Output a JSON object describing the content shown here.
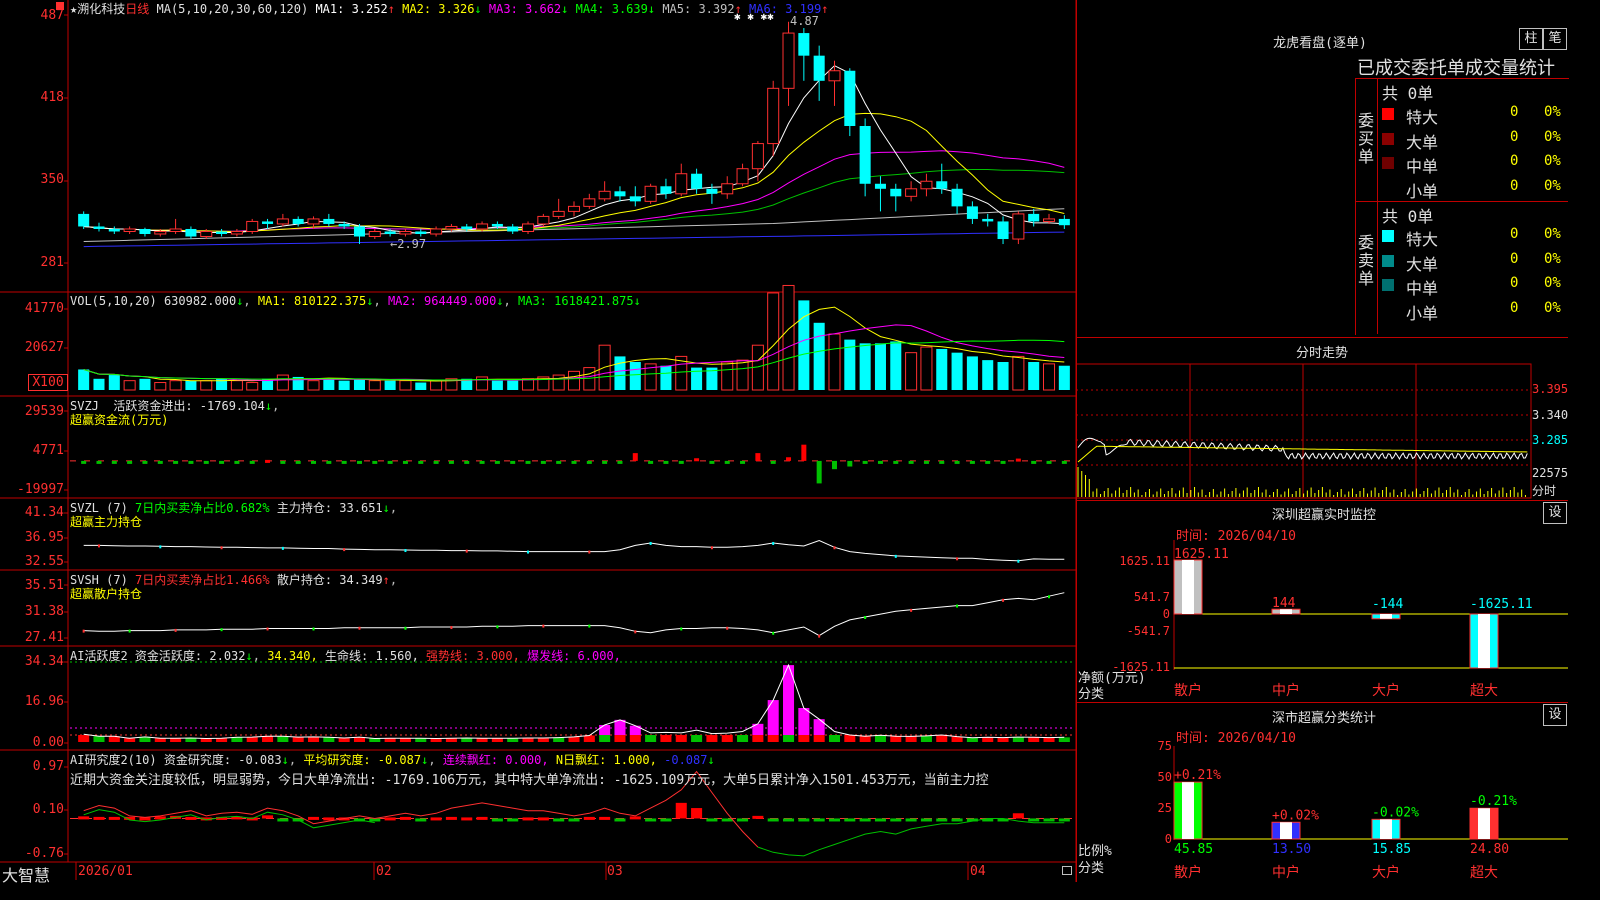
{
  "header": {
    "star": "★",
    "stock_name": "溯化科技",
    "period": "日线",
    "ma_label": "MA(5,10,20,30,60,120)",
    "ma1": "MA1: 3.252",
    "ma2": "MA2: 3.326",
    "ma3": "MA3: 3.662",
    "ma4": "MA4: 3.639",
    "ma5": "MA5: 3.392",
    "ma6": "MA6: 3.199",
    "up_arrow": "↑",
    "down_arrow": "↓",
    "peak_label": "4.87",
    "peak_marks": "✱  ✱  ✱✱",
    "low_label": "←2.97"
  },
  "price_axis": [
    "487",
    "418",
    "350",
    "281"
  ],
  "vol_header": {
    "label": "VOL(5,10,20)",
    "value": "630982.000",
    "ma1": "MA1: 810122.375",
    "ma2": "MA2: 964449.000",
    "ma3": "MA3: 1618421.875"
  },
  "vol_axis": [
    "41770",
    "20627",
    "X100"
  ],
  "svzj_header": {
    "code": "SVZJ",
    "text": "活跃资金进出: -1769.104",
    "sub": "超赢资金流(万元)"
  },
  "svzj_axis": [
    "29539",
    "4771",
    "-19997"
  ],
  "svzl_header": {
    "code": "SVZL (7)",
    "ratio": "7日内买卖净占比0.682%",
    "pos": "主力持仓: 33.651",
    "sub": "超赢主力持仓"
  },
  "svzl_axis": [
    "41.34",
    "36.95",
    "32.55"
  ],
  "svsh_header": {
    "code": "SVSH (7)",
    "ratio": "7日内买卖净占比1.466%",
    "pos": "散户持仓: 34.349",
    "sub": "超赢散户持仓"
  },
  "svsh_axis": [
    "35.51",
    "31.38",
    "27.41"
  ],
  "ai_active_header": {
    "code": "AI活跃度2",
    "a": "资金活跃度: 2.032",
    "b": "34.340,",
    "c": "生命线: 1.560,",
    "d": "强势线: 3.000,",
    "e": "爆发线: 6.000,"
  },
  "ai_active_axis": [
    "34.34",
    "16.96",
    "0.00"
  ],
  "ai_research_header": {
    "code": "AI研究度2(10)",
    "a": "资金研究度: -0.083",
    "b": "平均研究度: -0.087",
    "c": "连续飘红: 0.000,",
    "d": "N日飘红: 1.000,",
    "e": "-0.087",
    "summary": "近期大资金关注度较低，明显弱势，今日大单净流出: -1769.106万元，其中特大单净流出: -1625.109万元，大单5日累计净入1501.453万元，当前主力控"
  },
  "ai_research_axis": [
    "0.97",
    "0.10",
    "-0.76"
  ],
  "dates": [
    "2026/01",
    "02",
    "03",
    "04"
  ],
  "logo": "大智慧",
  "right": {
    "lhb_title": "龙虎看盘(逐单)",
    "btn_bar": "柱",
    "btn_pen": "笔",
    "stat_title": "已成交委托单成交量统计",
    "buy_label": "委买单",
    "sell_label": "委卖单",
    "buy_total": "共 0单",
    "sell_total": "共 0单",
    "buy_rows": [
      {
        "name": "特大",
        "v": "0",
        "p": "0%",
        "color": "#ff0000"
      },
      {
        "name": "大单",
        "v": "0",
        "p": "0%",
        "color": "#8b0000"
      },
      {
        "name": "中单",
        "v": "0",
        "p": "0%",
        "color": "#700000"
      },
      {
        "name": "小单",
        "v": "0",
        "p": "0%",
        "color": "#000000"
      }
    ],
    "sell_rows": [
      {
        "name": "特大",
        "v": "0",
        "p": "0%",
        "color": "#00ffff"
      },
      {
        "name": "大单",
        "v": "0",
        "p": "0%",
        "color": "#008b8b"
      },
      {
        "name": "中单",
        "v": "0",
        "p": "0%",
        "color": "#007070"
      },
      {
        "name": "小单",
        "v": "0",
        "p": "0%",
        "color": "#000000"
      }
    ],
    "minute_title": "分时走势",
    "minute_axis": [
      "3.395",
      "3.340",
      "3.285",
      "22575"
    ],
    "minute_unit": "分时",
    "monitor_title": "深圳超赢实时监控",
    "monitor_setting": "设",
    "monitor_time": "时间: 2026/04/10",
    "monitor_axis": [
      "1625.11",
      "541.7",
      "0",
      "-541.7",
      "-1625.11"
    ],
    "monitor_unit": "净额(万元)",
    "monitor_cat_label": "分类",
    "monitor_values": [
      {
        "cat": "散户",
        "label": "1625.11",
        "value": 1625.11
      },
      {
        "cat": "中户",
        "label": "144",
        "value": 144
      },
      {
        "cat": "大户",
        "label": "-144",
        "value": -144
      },
      {
        "cat": "超大",
        "label": "-1625.11",
        "value": -1625.11
      }
    ],
    "class_title": "深市超赢分类统计",
    "class_setting": "设",
    "class_time": "时间: 2026/04/10",
    "class_axis": [
      "75",
      "50",
      "25",
      "0"
    ],
    "class_unit": "比例%",
    "class_cat_label": "分类",
    "class_values": [
      {
        "cat": "散户",
        "value": 45.85,
        "label": "45.85",
        "delta": "+0.21%"
      },
      {
        "cat": "中户",
        "value": 13.5,
        "label": "13.50",
        "delta": "+0.02%"
      },
      {
        "cat": "大户",
        "value": 15.85,
        "label": "15.85",
        "delta": "-0.02%"
      },
      {
        "cat": "超大",
        "value": 24.8,
        "label": "24.80",
        "delta": "-0.21%"
      }
    ]
  },
  "chart_data": {
    "type": "candlestick",
    "candles": [
      [
        3.34,
        3.24,
        3.36,
        3.22
      ],
      [
        3.24,
        3.22,
        3.27,
        3.2
      ],
      [
        3.22,
        3.2,
        3.24,
        3.18
      ],
      [
        3.2,
        3.22,
        3.24,
        3.18
      ],
      [
        3.22,
        3.18,
        3.23,
        3.16
      ],
      [
        3.18,
        3.2,
        3.22,
        3.16
      ],
      [
        3.2,
        3.22,
        3.3,
        3.18
      ],
      [
        3.22,
        3.16,
        3.24,
        3.14
      ],
      [
        3.16,
        3.2,
        3.22,
        3.14
      ],
      [
        3.2,
        3.18,
        3.22,
        3.16
      ],
      [
        3.18,
        3.2,
        3.22,
        3.16
      ],
      [
        3.2,
        3.28,
        3.3,
        3.18
      ],
      [
        3.28,
        3.26,
        3.3,
        3.22
      ],
      [
        3.26,
        3.3,
        3.34,
        3.24
      ],
      [
        3.3,
        3.26,
        3.32,
        3.24
      ],
      [
        3.26,
        3.3,
        3.32,
        3.22
      ],
      [
        3.3,
        3.26,
        3.34,
        3.24
      ],
      [
        3.26,
        3.24,
        3.28,
        3.22
      ],
      [
        3.24,
        3.16,
        3.26,
        3.1
      ],
      [
        3.16,
        3.2,
        3.22,
        3.14
      ],
      [
        3.2,
        3.18,
        3.22,
        3.16
      ],
      [
        3.18,
        3.2,
        3.22,
        3.16
      ],
      [
        3.2,
        3.18,
        3.22,
        3.16
      ],
      [
        3.18,
        3.22,
        3.24,
        3.16
      ],
      [
        3.22,
        3.24,
        3.26,
        3.2
      ],
      [
        3.24,
        3.22,
        3.26,
        3.2
      ],
      [
        3.22,
        3.26,
        3.28,
        3.2
      ],
      [
        3.26,
        3.24,
        3.28,
        3.22
      ],
      [
        3.24,
        3.2,
        3.26,
        3.18
      ],
      [
        3.2,
        3.26,
        3.28,
        3.18
      ],
      [
        3.26,
        3.32,
        3.34,
        3.24
      ],
      [
        3.32,
        3.36,
        3.46,
        3.3
      ],
      [
        3.36,
        3.4,
        3.44,
        3.32
      ],
      [
        3.4,
        3.46,
        3.5,
        3.38
      ],
      [
        3.46,
        3.52,
        3.6,
        3.44
      ],
      [
        3.52,
        3.48,
        3.56,
        3.44
      ],
      [
        3.48,
        3.44,
        3.56,
        3.4
      ],
      [
        3.44,
        3.56,
        3.58,
        3.42
      ],
      [
        3.56,
        3.5,
        3.62,
        3.46
      ],
      [
        3.5,
        3.66,
        3.74,
        3.48
      ],
      [
        3.66,
        3.54,
        3.7,
        3.5
      ],
      [
        3.54,
        3.5,
        3.58,
        3.42
      ],
      [
        3.5,
        3.58,
        3.64,
        3.46
      ],
      [
        3.58,
        3.7,
        3.74,
        3.56
      ],
      [
        3.7,
        3.9,
        3.92,
        3.6
      ],
      [
        3.9,
        4.34,
        4.4,
        3.8
      ],
      [
        4.34,
        4.78,
        4.87,
        4.2
      ],
      [
        4.78,
        4.6,
        4.82,
        4.4
      ],
      [
        4.6,
        4.4,
        4.68,
        4.24
      ],
      [
        4.4,
        4.48,
        4.56,
        4.2
      ],
      [
        4.48,
        4.04,
        4.5,
        3.96
      ],
      [
        4.04,
        3.58,
        4.1,
        3.48
      ],
      [
        3.58,
        3.54,
        3.64,
        3.36
      ],
      [
        3.54,
        3.48,
        3.58,
        3.36
      ],
      [
        3.48,
        3.54,
        3.6,
        3.44
      ],
      [
        3.54,
        3.6,
        3.66,
        3.48
      ],
      [
        3.6,
        3.54,
        3.74,
        3.5
      ],
      [
        3.54,
        3.4,
        3.58,
        3.34
      ],
      [
        3.4,
        3.3,
        3.44,
        3.26
      ],
      [
        3.3,
        3.28,
        3.34,
        3.24
      ],
      [
        3.28,
        3.14,
        3.32,
        3.1
      ],
      [
        3.14,
        3.34,
        3.36,
        3.1
      ],
      [
        3.34,
        3.28,
        3.38,
        3.24
      ],
      [
        3.28,
        3.3,
        3.34,
        3.26
      ],
      [
        3.3,
        3.25,
        3.33,
        3.22
      ]
    ],
    "ylim": [
      2.75,
      4.9
    ],
    "volumes": [
      11,
      6,
      8,
      5,
      6,
      4,
      5,
      5,
      5,
      6,
      5,
      4,
      6,
      8,
      7,
      5,
      6,
      5,
      6,
      5,
      5,
      5,
      4,
      5,
      6,
      6,
      7,
      5,
      5,
      6,
      7,
      8,
      10,
      12,
      24,
      18,
      15,
      14,
      13,
      18,
      12,
      12,
      15,
      16,
      24,
      52,
      56,
      48,
      36,
      30,
      27,
      25,
      25,
      26,
      20,
      23,
      22,
      20,
      18,
      16,
      15,
      18,
      15,
      14,
      13
    ],
    "vol_ylim": [
      0,
      45
    ],
    "svzj": [
      -700,
      -500,
      -500,
      -400,
      -400,
      -300,
      -300,
      -400,
      -400,
      -500,
      -400,
      -300,
      600,
      -300,
      -400,
      -400,
      -300,
      -300,
      -300,
      -300,
      -300,
      -300,
      -400,
      -300,
      -300,
      -300,
      -300,
      -300,
      -300,
      -300,
      -300,
      -400,
      -400,
      -300,
      -400,
      -300,
      4700,
      -1200,
      -1500,
      -700,
      1600,
      -1500,
      -900,
      -300,
      4700,
      -1800,
      2200,
      9800,
      -13600,
      -5000,
      -3400,
      -1400,
      -300,
      -300,
      -300,
      -1700,
      -1400,
      -300,
      -300,
      -300,
      -300,
      1400,
      -300,
      -300,
      -1769
    ],
    "svzj_ylim": [
      -19997,
      29539
    ],
    "svzl": [
      35.9,
      35.9,
      35.85,
      35.8,
      35.8,
      35.75,
      35.7,
      35.7,
      35.65,
      35.6,
      35.6,
      35.55,
      35.5,
      35.5,
      35.45,
      35.4,
      35.4,
      35.3,
      35.25,
      35.2,
      35.2,
      35.15,
      35.1,
      35.1,
      35.05,
      35.05,
      35.0,
      35.0,
      34.95,
      34.9,
      34.9,
      34.9,
      34.9,
      34.9,
      34.9,
      35.2,
      35.9,
      36.3,
      35.9,
      35.7,
      35.7,
      35.6,
      35.6,
      35.7,
      35.9,
      36.3,
      36.0,
      35.8,
      36.7,
      35.6,
      34.9,
      34.6,
      34.4,
      34.2,
      34.1,
      34.0,
      33.9,
      33.8,
      33.8,
      33.6,
      33.5,
      33.4,
      33.7,
      33.65,
      33.65
    ],
    "svzl_ylim": [
      32.55,
      41.34
    ],
    "svsh": [
      29.0,
      28.9,
      28.9,
      29.0,
      29.0,
      29.0,
      29.1,
      29.1,
      29.1,
      29.2,
      29.2,
      29.2,
      29.3,
      29.3,
      29.3,
      29.3,
      29.3,
      29.4,
      29.4,
      29.4,
      29.4,
      29.4,
      29.5,
      29.5,
      29.5,
      29.5,
      29.6,
      29.6,
      29.6,
      29.7,
      29.7,
      29.7,
      29.7,
      29.7,
      29.7,
      29.4,
      28.9,
      28.7,
      29.1,
      29.3,
      29.3,
      29.4,
      29.4,
      29.3,
      29.1,
      28.7,
      29.1,
      29.5,
      28.3,
      29.6,
      30.5,
      30.9,
      31.3,
      31.7,
      31.9,
      32.1,
      32.3,
      32.5,
      32.5,
      32.9,
      33.3,
      33.5,
      33.3,
      33.8,
      34.3
    ],
    "svsh_ylim": [
      27.41,
      35.51
    ],
    "ai_active": [
      3.3,
      2.5,
      2.5,
      1.6,
      2.2,
      1.6,
      1.6,
      1.7,
      1.5,
      1.6,
      2.0,
      2.1,
      2.5,
      2.5,
      2.1,
      2.2,
      2.0,
      1.7,
      2.1,
      1.5,
      1.6,
      1.6,
      1.6,
      1.5,
      1.6,
      1.7,
      1.6,
      1.6,
      1.6,
      1.7,
      1.7,
      1.9,
      2.2,
      2.8,
      7.3,
      9.5,
      7.0,
      3.9,
      4.1,
      3.9,
      5.1,
      3.6,
      3.8,
      4.5,
      7.8,
      18.0,
      33.0,
      14.6,
      9.8,
      4.5,
      3.0,
      2.5,
      2.9,
      2.5,
      2.4,
      2.6,
      3.0,
      2.3,
      1.8,
      2.0,
      1.9,
      2.1,
      2.0,
      1.9,
      2.0
    ],
    "ai_active_ylim": [
      0,
      34.34
    ],
    "ai_research": [
      0.15,
      0.25,
      0.2,
      0.05,
      0.02,
      0.05,
      0.1,
      0.15,
      0.05,
      0.1,
      0.12,
      0.08,
      0.2,
      0.15,
      0.05,
      -0.1,
      -0.05,
      0.0,
      0.05,
      0.0,
      0.05,
      0.1,
      0.05,
      0.1,
      0.2,
      0.25,
      0.3,
      0.25,
      0.2,
      0.15,
      0.15,
      0.1,
      0.05,
      0.1,
      0.2,
      0.1,
      0.05,
      0.2,
      0.35,
      0.55,
      0.9,
      0.5,
      0.1,
      -0.25,
      -0.55,
      -0.65,
      -0.7,
      -0.72,
      -0.6,
      -0.5,
      -0.4,
      -0.3,
      -0.25,
      -0.3,
      -0.2,
      -0.15,
      -0.1,
      -0.1,
      -0.05,
      0.0,
      0.0,
      -0.05,
      -0.083,
      -0.083,
      -0.083
    ],
    "ai_research_ylim": [
      -0.76,
      0.97
    ]
  }
}
